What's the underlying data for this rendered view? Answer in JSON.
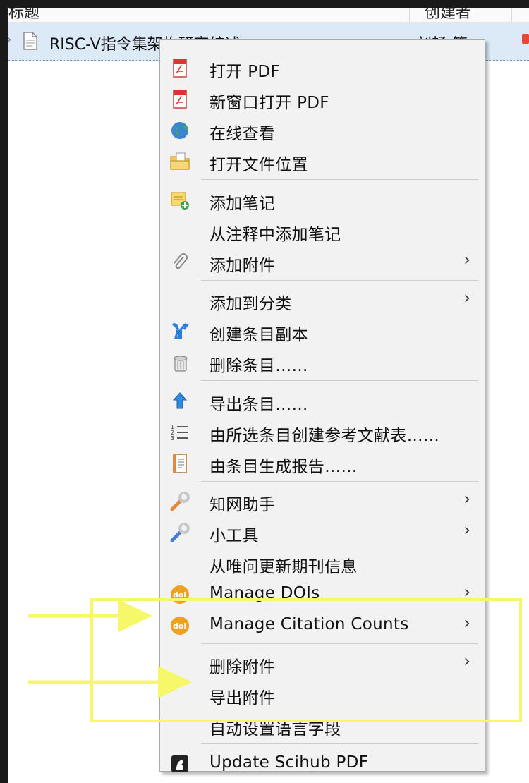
{
  "list": {
    "columns": {
      "title": "标题",
      "creator": "创建者"
    },
    "selected_item": {
      "title": "RISC-V指令集架构研究综述",
      "creator": "刘畅 等"
    }
  },
  "context_menu": {
    "items": [
      {
        "label": "打开 PDF",
        "icon": "pdf-icon"
      },
      {
        "label": "新窗口打开 PDF",
        "icon": "pdf-icon"
      },
      {
        "label": "在线查看",
        "icon": "globe-icon"
      },
      {
        "label": "打开文件位置",
        "icon": "folder-icon"
      },
      {
        "label": "添加笔记",
        "icon": "add-note-icon"
      },
      {
        "label": "从注释中添加笔记",
        "icon": ""
      },
      {
        "label": "添加附件",
        "icon": "paperclip-icon",
        "submenu": true
      },
      {
        "label": "添加到分类",
        "icon": "",
        "submenu": true
      },
      {
        "label": "创建条目副本",
        "icon": "duplicate-icon"
      },
      {
        "label": "删除条目……",
        "icon": "trash-icon"
      },
      {
        "label": "导出条目……",
        "icon": "export-arrow-icon"
      },
      {
        "label": "由所选条目创建参考文献表……",
        "icon": "numbered-list-icon"
      },
      {
        "label": "由条目生成报告……",
        "icon": "report-icon"
      },
      {
        "label": "知网助手",
        "icon": "wrench-orange-icon",
        "submenu": true
      },
      {
        "label": "小工具",
        "icon": "wrench-blue-icon",
        "submenu": true
      },
      {
        "label": "从唯问更新期刊信息",
        "icon": ""
      },
      {
        "label": "Manage DOIs",
        "icon": "doi-icon",
        "submenu": true
      },
      {
        "label": "Manage Citation Counts",
        "icon": "doi-icon",
        "submenu": true
      },
      {
        "label": "删除附件",
        "icon": "",
        "submenu": true
      },
      {
        "label": "导出附件",
        "icon": ""
      },
      {
        "label": "自动设置语言字段",
        "icon": ""
      },
      {
        "label": "Update Scihub PDF",
        "icon": "scihub-icon"
      }
    ],
    "submenu_arrow": "›"
  },
  "colors": {
    "annotation": "#f7f76a",
    "selection": "#dceaf8",
    "menu_bg": "#f2f2f2"
  }
}
